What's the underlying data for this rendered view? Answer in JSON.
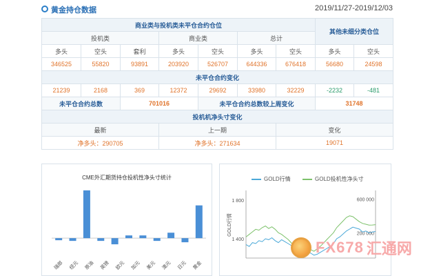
{
  "header": {
    "title": "黄金持仓数据",
    "date_range": "2019/11/27-2019/12/03"
  },
  "table": {
    "section_main": "商业类与投机类未平仓合约仓位",
    "section_other": "其他未细分类仓位",
    "group_spec": "投机类",
    "group_comm": "商业类",
    "group_total": "总计",
    "col_long": "多头",
    "col_short": "空头",
    "col_spread": "套利",
    "values": [
      "346525",
      "55820",
      "93891",
      "203920",
      "526707",
      "644336",
      "676418",
      "56680",
      "24598"
    ],
    "section_change": "未平仓合约变化",
    "changes": [
      "21239",
      "2168",
      "369",
      "12372",
      "29692",
      "33980",
      "32229",
      "-2232",
      "-481"
    ],
    "oi_total_label": "未平仓合约总数",
    "oi_total_value": "701016",
    "oi_change_label": "未平仓合约总数较上周变化",
    "oi_change_value": "31748",
    "section_net": "投机机净头寸变化",
    "net_latest_label": "最新",
    "net_prev_label": "上一期",
    "net_change_label": "变化",
    "net_latest_value": "净多头：290705",
    "net_prev_value": "净多头：271634",
    "net_change_value": "19071"
  },
  "chart_data": [
    {
      "type": "bar",
      "title": "CME外汇期货持仓投机性净头寸统计",
      "categories": [
        "瑞郎",
        "纽元",
        "原油",
        "英镑",
        "欧元",
        "加元",
        "美元",
        "澳元",
        "日元",
        "黄金"
      ],
      "values": [
        -3,
        -4,
        70,
        -4,
        -9,
        4,
        4,
        -4,
        8,
        -6,
        48
      ],
      "ylim": [
        -15,
        80
      ],
      "color": "#4a8fd6"
    },
    {
      "type": "line",
      "series": [
        {
          "name": "GOLD行情",
          "color": "#4aa8d8"
        },
        {
          "name": "GOLD投机性净头寸",
          "color": "#7cc16a"
        }
      ],
      "left_ticks": [
        "1 800",
        "1 400"
      ],
      "right_ticks": [
        "600 000",
        "200 000"
      ],
      "ylabel_left": "GOLD行情",
      "gold_price": [
        1340,
        1320,
        1360,
        1350,
        1380,
        1370,
        1400,
        1390,
        1410,
        1380,
        1360,
        1390,
        1370,
        1350,
        1330,
        1320,
        1300,
        1280,
        1260,
        1270,
        1250,
        1230,
        1240,
        1260,
        1280,
        1300,
        1320,
        1350,
        1400,
        1420,
        1450,
        1480,
        1500,
        1520,
        1510,
        1500,
        1470,
        1480,
        1460,
        1470,
        1475
      ],
      "net_position": [
        150000,
        180000,
        210000,
        240000,
        230000,
        260000,
        280000,
        250000,
        270000,
        240000,
        200000,
        180000,
        150000,
        120000,
        80000,
        40000,
        20000,
        -10000,
        -40000,
        -30000,
        0,
        -20000,
        10000,
        40000,
        80000,
        120000,
        160000,
        200000,
        260000,
        300000,
        340000,
        380000,
        400000,
        390000,
        360000,
        330000,
        310000,
        300000,
        290000,
        290705,
        295000
      ]
    }
  ],
  "watermark": {
    "brand": "FX678",
    "cn": "汇通网"
  }
}
